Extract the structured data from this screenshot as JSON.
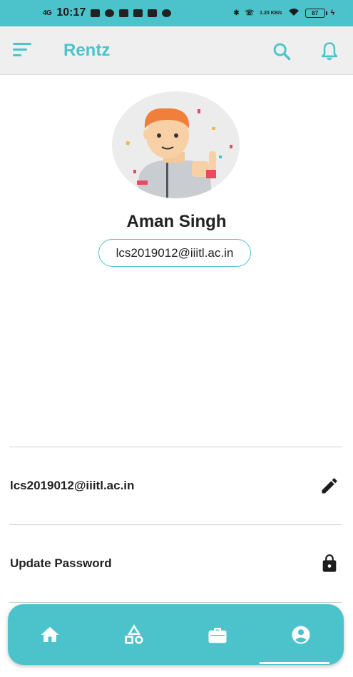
{
  "status_bar": {
    "network": "4G",
    "time": "10:17",
    "speed": "1.20 KB/s",
    "battery": "87"
  },
  "app_bar": {
    "title": "Rentz"
  },
  "profile": {
    "name": "Aman Singh",
    "email": "lcs2019012@iiitl.ac.in"
  },
  "settings": {
    "email_row": "lcs2019012@iiitl.ac.in",
    "password_row": "Update Password"
  },
  "bottom_nav": {
    "items": [
      "home-icon",
      "category-icon",
      "briefcase-icon",
      "account-icon"
    ],
    "active": "account-icon"
  },
  "colors": {
    "accent": "#4cc3cb"
  }
}
